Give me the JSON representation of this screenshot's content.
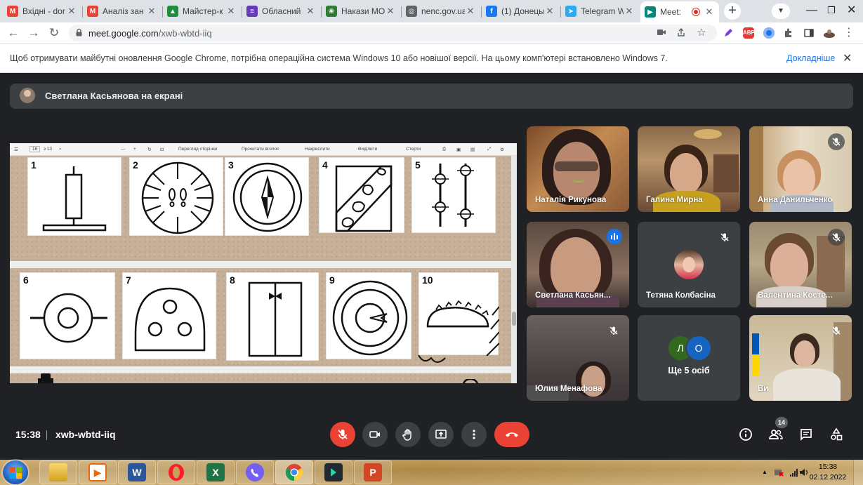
{
  "browser": {
    "tabs": [
      {
        "title": "Вхідні - dor",
        "favicon": "gmail-icon",
        "color": "#ea4335"
      },
      {
        "title": "Аналіз зан",
        "favicon": "gmail-icon",
        "color": "#ea4335"
      },
      {
        "title": "Майстер-к",
        "favicon": "drive-icon",
        "color": "#1e8e3e"
      },
      {
        "title": "Обласний",
        "favicon": "forms-icon",
        "color": "#673ab7"
      },
      {
        "title": "Накази МО",
        "favicon": "emblem-icon",
        "color": "#2e7d32"
      },
      {
        "title": "nenc.gov.ua",
        "favicon": "globe-icon",
        "color": "#5f6368"
      },
      {
        "title": "(1) Донецьк",
        "favicon": "facebook-icon",
        "color": "#1877f2"
      },
      {
        "title": "Telegram W",
        "favicon": "telegram-icon",
        "color": "#2aabee"
      },
      {
        "title": "Meet: ",
        "favicon": "meet-icon",
        "color": "#00897b",
        "active": true
      }
    ],
    "url_domain": "meet.google.com",
    "url_path": "/xwb-wbtd-iiq",
    "extensions": [
      "pen-icon",
      "adblock-icon",
      "sync-icon",
      "puzzle-icon",
      "sidepanel-icon",
      "profile-icon"
    ],
    "adblock_label": "ABP"
  },
  "infobar": {
    "message": "Щоб отримувати майбутні оновлення Google Chrome, потрібна операційна система Windows 10 або новішої версії. На цьому комп'ютері встановлено Windows 7.",
    "more_link": "Докладніше",
    "close_glyph": "✕"
  },
  "presentation": {
    "label": "Светлана Касьянова на екрані"
  },
  "pdf_toolbar": {
    "page": "16",
    "of_pages": "з 13",
    "items": [
      "Перегляд сторінки",
      "Прочитати вголос",
      "Накреслити",
      "Виділити",
      "Стерти"
    ]
  },
  "cards": [
    {
      "number": "1"
    },
    {
      "number": "2"
    },
    {
      "number": "3"
    },
    {
      "number": "4"
    },
    {
      "number": "5"
    },
    {
      "number": "6"
    },
    {
      "number": "7"
    },
    {
      "number": "8"
    },
    {
      "number": "9"
    },
    {
      "number": "10"
    }
  ],
  "participants": [
    {
      "name": "Наталія Рикунова",
      "muted": false
    },
    {
      "name": "Галина Мирна",
      "muted": false
    },
    {
      "name": "Анна Данильченко",
      "muted": true
    },
    {
      "name": "Светлана Касьян...",
      "muted": false,
      "speaking": true
    },
    {
      "name": "Тетяна Колбасіна",
      "muted": true
    },
    {
      "name": "Валентина Косте...",
      "muted": true
    },
    {
      "name": "Юлия Менафова",
      "muted": true
    },
    {
      "name": "",
      "muted": false,
      "group": true,
      "initials": [
        "Л",
        "О"
      ],
      "more_text": "Ще 5 осіб"
    },
    {
      "name": "Ви",
      "muted": true
    }
  ],
  "controls": {
    "time": "15:38",
    "meeting_code": "xwb-wbtd-iiq",
    "people_count": "14",
    "buttons": [
      "mic-off-icon",
      "camera-icon",
      "raise-hand-icon",
      "present-icon",
      "more-icon",
      "hangup-icon"
    ],
    "right_buttons": [
      "info-icon",
      "people-icon",
      "chat-icon",
      "activities-icon"
    ]
  },
  "taskbar": {
    "apps": [
      "explorer-icon",
      "media-player-icon",
      "word-icon",
      "opera-icon",
      "excel-icon",
      "viber-icon",
      "chrome-icon",
      "filmora-icon",
      "powerpoint-icon"
    ],
    "active_app": "chrome-icon",
    "time": "15:38",
    "date": "02.12.2022",
    "tray_up_arrow": "▲"
  }
}
